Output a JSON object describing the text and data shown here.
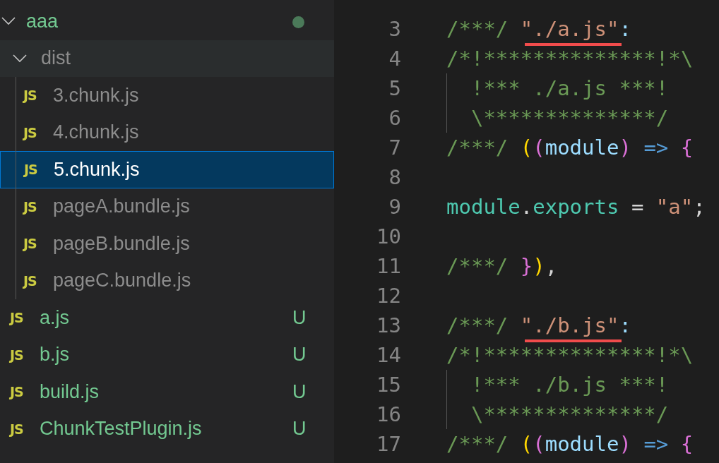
{
  "explorer": {
    "root": {
      "label": "aaa",
      "expanded": true,
      "modified": true,
      "children": [
        {
          "kind": "folder",
          "label": "dist",
          "expanded": true,
          "hovered": true,
          "ignored": true,
          "children": [
            {
              "kind": "file",
              "icon_text": "JS",
              "label": "3.chunk.js",
              "ignored": true,
              "selected": false
            },
            {
              "kind": "file",
              "icon_text": "JS",
              "label": "4.chunk.js",
              "ignored": true,
              "selected": false
            },
            {
              "kind": "file",
              "icon_text": "JS",
              "label": "5.chunk.js",
              "ignored": true,
              "selected": true
            },
            {
              "kind": "file",
              "icon_text": "JS",
              "label": "pageA.bundle.js",
              "ignored": true,
              "selected": false
            },
            {
              "kind": "file",
              "icon_text": "JS",
              "label": "pageB.bundle.js",
              "ignored": true,
              "selected": false
            },
            {
              "kind": "file",
              "icon_text": "JS",
              "label": "pageC.bundle.js",
              "ignored": true,
              "selected": false
            }
          ]
        },
        {
          "kind": "file",
          "icon_text": "JS",
          "label": "a.js",
          "ignored": false,
          "status": "U",
          "selected": false
        },
        {
          "kind": "file",
          "icon_text": "JS",
          "label": "b.js",
          "ignored": false,
          "status": "U",
          "selected": false
        },
        {
          "kind": "file",
          "icon_text": "JS",
          "label": "build.js",
          "ignored": false,
          "status": "U",
          "selected": false
        },
        {
          "kind": "file",
          "icon_text": "JS",
          "label": "ChunkTestPlugin.js",
          "ignored": false,
          "status": "U",
          "selected": false
        }
      ]
    }
  },
  "editor": {
    "lines": [
      {
        "number": "3",
        "tokens": [
          {
            "kind": "comment",
            "text": "/***/ "
          },
          {
            "kind": "string",
            "text": "\"./a.js\"",
            "underlined": true
          },
          {
            "kind": "key",
            "text": ":"
          }
        ]
      },
      {
        "number": "4",
        "tokens": [
          {
            "kind": "comment",
            "text": "/*!**************!*\\"
          }
        ]
      },
      {
        "number": "5",
        "guide": true,
        "tokens": [
          {
            "kind": "comment",
            "text": "  !*** ./a.js ***!"
          }
        ]
      },
      {
        "number": "6",
        "guide": true,
        "tokens": [
          {
            "kind": "comment",
            "text": "  \\**************/"
          }
        ]
      },
      {
        "number": "7",
        "tokens": [
          {
            "kind": "comment",
            "text": "/***/ "
          },
          {
            "kind": "bracket1",
            "text": "("
          },
          {
            "kind": "bracket2",
            "text": "("
          },
          {
            "kind": "variable",
            "text": "module"
          },
          {
            "kind": "bracket2",
            "text": ")"
          },
          {
            "kind": "operator",
            "text": " =>"
          },
          {
            "kind": "bracket2",
            "text": " {"
          }
        ]
      },
      {
        "number": "8"
      },
      {
        "number": "9",
        "tokens": [
          {
            "kind": "object",
            "text": "module"
          },
          {
            "kind": "plain",
            "text": "."
          },
          {
            "kind": "object",
            "text": "exports"
          },
          {
            "kind": "plain",
            "text": " = "
          },
          {
            "kind": "string",
            "text": "\"a\""
          },
          {
            "kind": "plain",
            "text": ";"
          }
        ]
      },
      {
        "number": "10"
      },
      {
        "number": "11",
        "tokens": [
          {
            "kind": "comment",
            "text": "/***/ "
          },
          {
            "kind": "bracket2",
            "text": "}"
          },
          {
            "kind": "bracket1",
            "text": ")"
          },
          {
            "kind": "plain",
            "text": ","
          }
        ]
      },
      {
        "number": "12"
      },
      {
        "number": "13",
        "tokens": [
          {
            "kind": "comment",
            "text": "/***/ "
          },
          {
            "kind": "string",
            "text": "\"./b.js\"",
            "underlined": true
          },
          {
            "kind": "key",
            "text": ":"
          }
        ]
      },
      {
        "number": "14",
        "tokens": [
          {
            "kind": "comment",
            "text": "/*!**************!*\\"
          }
        ]
      },
      {
        "number": "15",
        "guide": true,
        "tokens": [
          {
            "kind": "comment",
            "text": "  !*** ./b.js ***!"
          }
        ]
      },
      {
        "number": "16",
        "guide": true,
        "tokens": [
          {
            "kind": "comment",
            "text": "  \\**************/"
          }
        ]
      },
      {
        "number": "17",
        "tokens": [
          {
            "kind": "comment",
            "text": "/***/ "
          },
          {
            "kind": "bracket1",
            "text": "("
          },
          {
            "kind": "bracket2",
            "text": "("
          },
          {
            "kind": "variable",
            "text": "module"
          },
          {
            "kind": "bracket2",
            "text": ")"
          },
          {
            "kind": "operator",
            "text": " =>"
          },
          {
            "kind": "bracket2",
            "text": " {"
          }
        ]
      }
    ]
  }
}
